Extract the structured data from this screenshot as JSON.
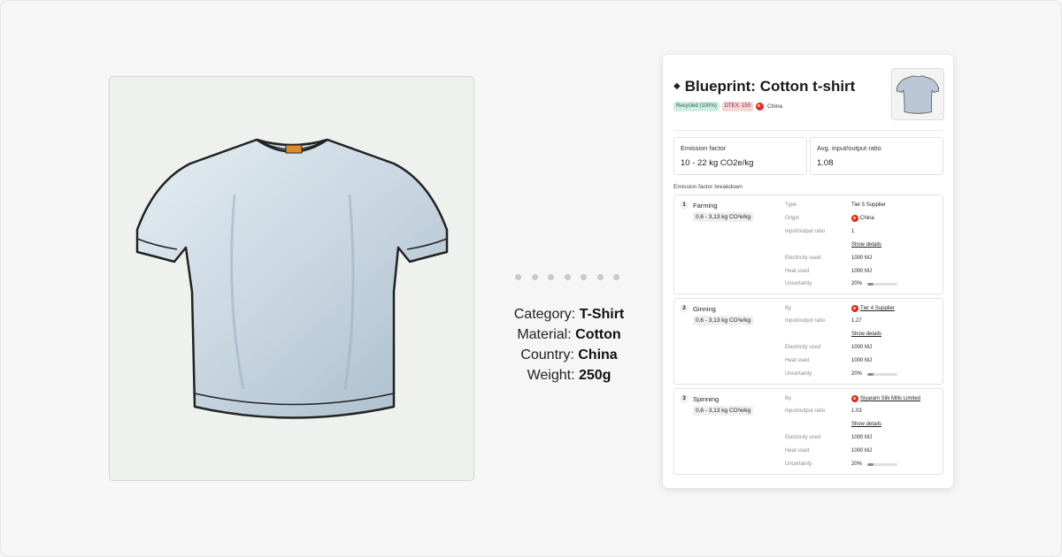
{
  "attributes": [
    {
      "label": "Category:",
      "value": "T-Shirt"
    },
    {
      "label": "Material:",
      "value": "Cotton"
    },
    {
      "label": "Country:",
      "value": "China"
    },
    {
      "label": "Weight:",
      "value": "250g"
    }
  ],
  "panel": {
    "title": "Blueprint: Cotton t-shirt",
    "badges": {
      "recycled": "Recycled (100%)",
      "dtex": "DTEX: 150",
      "country": "China"
    },
    "stats": {
      "emission_label": "Emission factor",
      "emission_value": "10 - 22 kg CO2e/kg",
      "ratio_label": "Avg. input/output ratio",
      "ratio_value": "1.08"
    },
    "breakdown_label": "Emission factor breakdown",
    "steps": [
      {
        "num": "1",
        "name": "Farming",
        "range": "0,6 - 3,13 kg CO²e/kg",
        "type_key": "Type",
        "type_val": "Tier 5 Supplier",
        "origin_key": "Origin",
        "origin_val": "China",
        "ratio_key": "Input/output ratio",
        "ratio_val": "1",
        "details": "Show details",
        "elec_key": "Electricity used",
        "elec_val": "1000 MJ",
        "heat_key": "Heat used",
        "heat_val": "1000 MJ",
        "unc_key": "Uncertainty",
        "unc_val": "20%",
        "uncertainty_fraction": 0.2
      },
      {
        "num": "2",
        "name": "Ginning",
        "range": "0,6 - 3,13 kg CO²e/kg",
        "by_key": "By",
        "by_val": "Tier 4 Supplier",
        "ratio_key": "Input/output ratio",
        "ratio_val": "1.27",
        "details": "Show details",
        "elec_key": "Electricity used",
        "elec_val": "1000 MJ",
        "heat_key": "Heat used",
        "heat_val": "1000 MJ",
        "unc_key": "Uncertainty",
        "unc_val": "20%",
        "uncertainty_fraction": 0.2
      },
      {
        "num": "3",
        "name": "Spinning",
        "range": "0,6 - 3,13 kg CO²e/kg",
        "by_key": "By",
        "by_val": "Siyaram Silk Mills Limited",
        "ratio_key": "Input/output ratio",
        "ratio_val": "1.03",
        "details": "Show details",
        "elec_key": "Electricity used",
        "elec_val": "1000 MJ",
        "heat_key": "Heat used",
        "heat_val": "1000 MJ",
        "unc_key": "Uncertainty",
        "unc_val": "20%",
        "uncertainty_fraction": 0.2
      }
    ]
  },
  "colors": {
    "flag_red": "#de2a2f",
    "badge_green": "#cfeee2",
    "badge_pink": "#f6d6d8",
    "shirt_fill": "#c9d7e1"
  },
  "icons": [
    "tshirt-illustration",
    "diamond-icon",
    "china-flag-icon"
  ]
}
